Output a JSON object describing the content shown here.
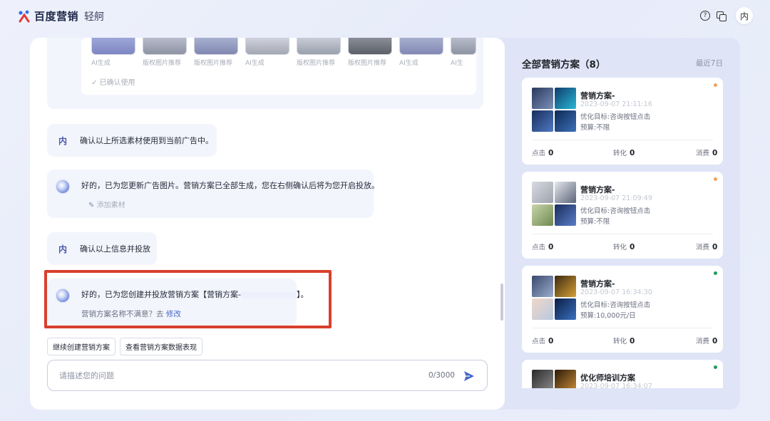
{
  "app": {
    "brand": "百度营销",
    "product": "轻舸"
  },
  "header": {
    "help_icon": "?",
    "avatar": "内"
  },
  "chat": {
    "thumb_labels": [
      "AI生成",
      "版权图片推荐",
      "版权图片推荐",
      "AI生成",
      "版权图片推荐",
      "版权图片推荐",
      "AI生成",
      "AI生"
    ],
    "confirm_used": "✓ 已确认使用",
    "user_msgs": [
      {
        "tag": "内",
        "text": "确认以上所选素材使用到当前广告中。"
      },
      {
        "tag": "内",
        "text": "确认以上信息并投放"
      }
    ],
    "ai_msgs": [
      {
        "text": "好的，已为您更新广告图片。营销方案已全部生成，您在右侧确认后将为您开启投放。",
        "sub": "添加素材"
      },
      {
        "text_prefix": "好的，已为您创建并投放营销方案【营销方案-",
        "text_suffix": "】。",
        "sub_prefix": "营销方案名称不满意？去 ",
        "sub_link": "修改"
      }
    ],
    "chips": [
      "继续创建营销方案",
      "查看营销方案数据表现"
    ],
    "input": {
      "placeholder": "请描述您的问题",
      "value": "",
      "counter": "0/3000"
    }
  },
  "side": {
    "title": "全部营销方案（8）",
    "recent": "最近7日",
    "plans": [
      {
        "name": "营销方案-",
        "date": "2023-09-07 21:11:16",
        "goal": "优化目标:咨询按钮点击",
        "budget": "预算:不限",
        "dot_color": "#f0a35e",
        "clicks_label": "点击",
        "clicks": "0",
        "conv_label": "转化",
        "conv": "0",
        "cost_label": "消费",
        "cost": "0"
      },
      {
        "name": "营销方案-",
        "date": "2023-09-07 21:09:49",
        "goal": "优化目标:咨询按钮点击",
        "budget": "预算:不限",
        "dot_color": "#f0a35e",
        "clicks_label": "点击",
        "clicks": "0",
        "conv_label": "转化",
        "conv": "0",
        "cost_label": "消费",
        "cost": "0"
      },
      {
        "name": "营销方案-",
        "date": "2023-09-07 16:34:30",
        "goal": "优化目标:咨询按钮点击",
        "budget": "预算:10,000元/日",
        "dot_color": "#1f9d5b",
        "clicks_label": "点击",
        "clicks": "0",
        "conv_label": "转化",
        "conv": "0",
        "cost_label": "消费",
        "cost": "0"
      },
      {
        "name": "优化师培训方案",
        "date": "2023-09-07 16:34:07",
        "dot_color": "#1f9d5b"
      }
    ]
  },
  "colors": {
    "accent": "#4766c8",
    "highlight_border": "#d8402c"
  }
}
